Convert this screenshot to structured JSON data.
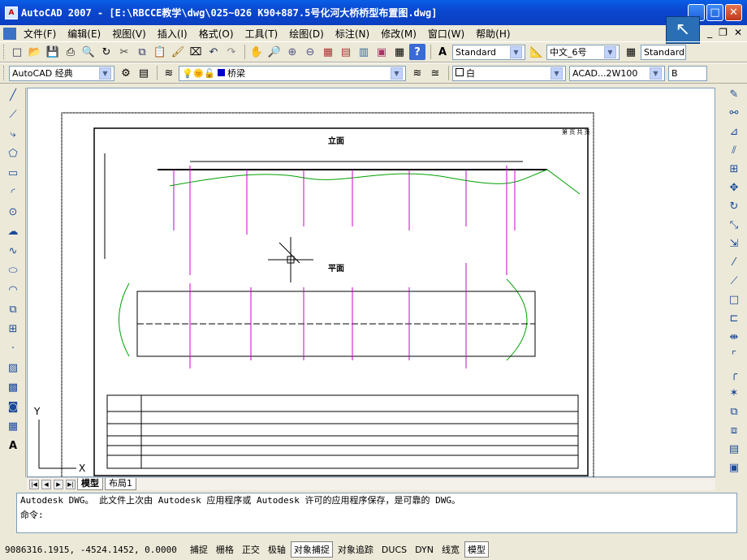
{
  "window": {
    "title": "AutoCAD 2007 - [E:\\RBCCE教学\\dwg\\025~026 K90+887.5号化河大桥桥型布置图.dwg]",
    "icon_text": "A"
  },
  "menu": [
    "文件(F)",
    "编辑(E)",
    "视图(V)",
    "插入(I)",
    "格式(O)",
    "工具(T)",
    "绘图(D)",
    "标注(N)",
    "修改(M)",
    "窗口(W)",
    "帮助(H)"
  ],
  "toolbar2": {
    "text_style": "Standard",
    "dim_style": "中文_6号",
    "table_style": "Standard"
  },
  "toolbar3": {
    "workspace": "AutoCAD 经典",
    "layer": "桥梁",
    "color": "白",
    "linetype": "ACAD...2W100",
    "lineweight": "B"
  },
  "drawing": {
    "elevation_title": "立面",
    "plan_title": "平面",
    "top_right": "第 页 共 页"
  },
  "tabs": [
    "模型",
    "布局1"
  ],
  "command": {
    "line1": "Autodesk DWG。  此文件上次由 Autodesk 应用程序或 Autodesk 许可的应用程序保存，是可靠的 DWG。",
    "prompt": "命令:"
  },
  "status": {
    "coords": "9086316.1915, -4524.1452, 0.0000",
    "buttons": [
      "捕捉",
      "栅格",
      "正交",
      "极轴",
      "对象捕捉",
      "对象追踪",
      "DUCS",
      "DYN",
      "线宽",
      "模型"
    ],
    "active": [
      false,
      false,
      false,
      false,
      true,
      false,
      false,
      false,
      false,
      true
    ]
  },
  "colors": {
    "titlebar": "#0a46cf",
    "magenta": "#cc00cc",
    "green": "#00a000"
  }
}
